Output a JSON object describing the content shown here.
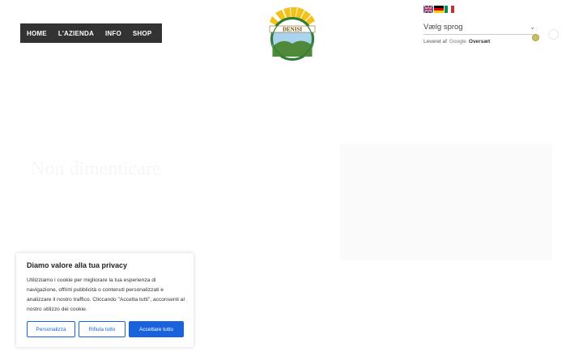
{
  "nav": {
    "items": [
      "HOME",
      "L'AZIENDA",
      "INFO",
      "SHOP"
    ],
    "more_glyph": "⋮"
  },
  "logo": {
    "text": "DENISI",
    "colors": {
      "sun": "#f2c21b",
      "ring": "#2e7d32",
      "sky": "#a9d3ee",
      "hills": "#4f8a3a"
    }
  },
  "language": {
    "flags": [
      "en-flag",
      "de-flag",
      "it-flag"
    ],
    "select_label": "Vælg sprog",
    "powered_prefix": "Leveret af",
    "powered_brand": "Google",
    "powered_action": "Oversæt"
  },
  "hero": {
    "title": "Non dimenticare"
  },
  "cookie": {
    "title": "Diamo valore alla tua privacy",
    "body": "Utilizziamo i cookie per migliorare la tua esperienza di navigazione, offrirti pubblicità o contenuti personalizzati e analizzare il nostro traffico. Cliccando \"Accetta tutti\", acconsenti al nostro utilizzo dei cookie.",
    "buttons": {
      "customize": "Personalizza",
      "reject": "Rifiuta tutto",
      "accept": "Accettare tutto"
    },
    "accent": "#1863dc"
  }
}
